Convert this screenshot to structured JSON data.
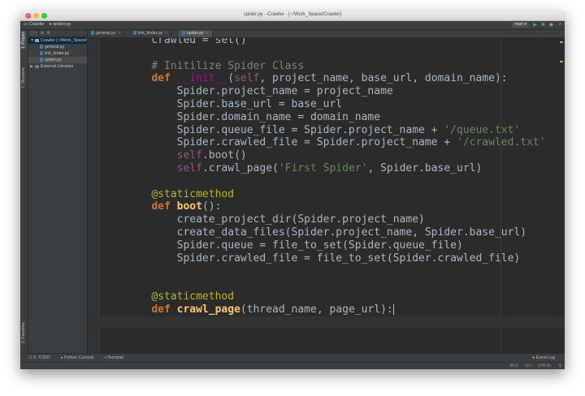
{
  "window": {
    "title": "spider.py - Crawler - [~/Work_Space/Crawler]"
  },
  "navbar": {
    "project_crumb": "Crawler",
    "file_crumb": "spider.py",
    "run_config": "main ▾"
  },
  "left_tools": {
    "project": "1: Project",
    "structure": "7: Structure",
    "favorites": "2: Favorites"
  },
  "project_tree": [
    {
      "name": "Crawler (~/Work_Space/Crawler)",
      "type": "folder",
      "indent": 1,
      "arrow": "▼"
    },
    {
      "name": "general.py",
      "type": "py",
      "indent": 2,
      "arrow": ""
    },
    {
      "name": "link_finder.py",
      "type": "py",
      "indent": 2,
      "arrow": ""
    },
    {
      "name": "spider.py",
      "type": "py",
      "indent": 2,
      "arrow": ""
    },
    {
      "name": "External Libraries",
      "type": "lib",
      "indent": 1,
      "arrow": "▶"
    }
  ],
  "tabs": [
    {
      "label": "general.py"
    },
    {
      "label": "link_finder.py"
    },
    {
      "label": "spider.py"
    }
  ],
  "bottom_tools": {
    "todo": "6: TODO",
    "console": "Python Console",
    "terminal": "Terminal",
    "event_log": "Event Log"
  },
  "status": {
    "position": "36:9",
    "line_sep": "LF÷",
    "encoding": "UTF-8÷"
  },
  "code_lines": [
    "    crawled = set()",
    "",
    "    # Initilize Spider Class",
    "    def __init__(self, project_name, base_url, domain_name):",
    "        Spider.project_name = project_name",
    "        Spider.base_url = base_url",
    "        Spider.domain_name = domain_name",
    "        Spider.queue_file = Spider.project_name + '/queue.txt'",
    "        Spider.crawled_file = Spider.project_name + '/crawled.txt'",
    "        self.boot()",
    "        self.crawl_page('First Spider', Spider.base_url)",
    "",
    "    @staticmethod",
    "    def boot():",
    "        create_project_dir(Spider.project_name)",
    "        create_data_files(Spider.project_name, Spider.base_url)",
    "        Spider.queue = file_to_set(Spider.queue_file)",
    "        Spider.crawled_file = file_to_set(Spider.crawled_file)",
    "",
    "",
    "    @staticmethod",
    "    def crawl_page(thread_name, page_url):",
    ""
  ]
}
